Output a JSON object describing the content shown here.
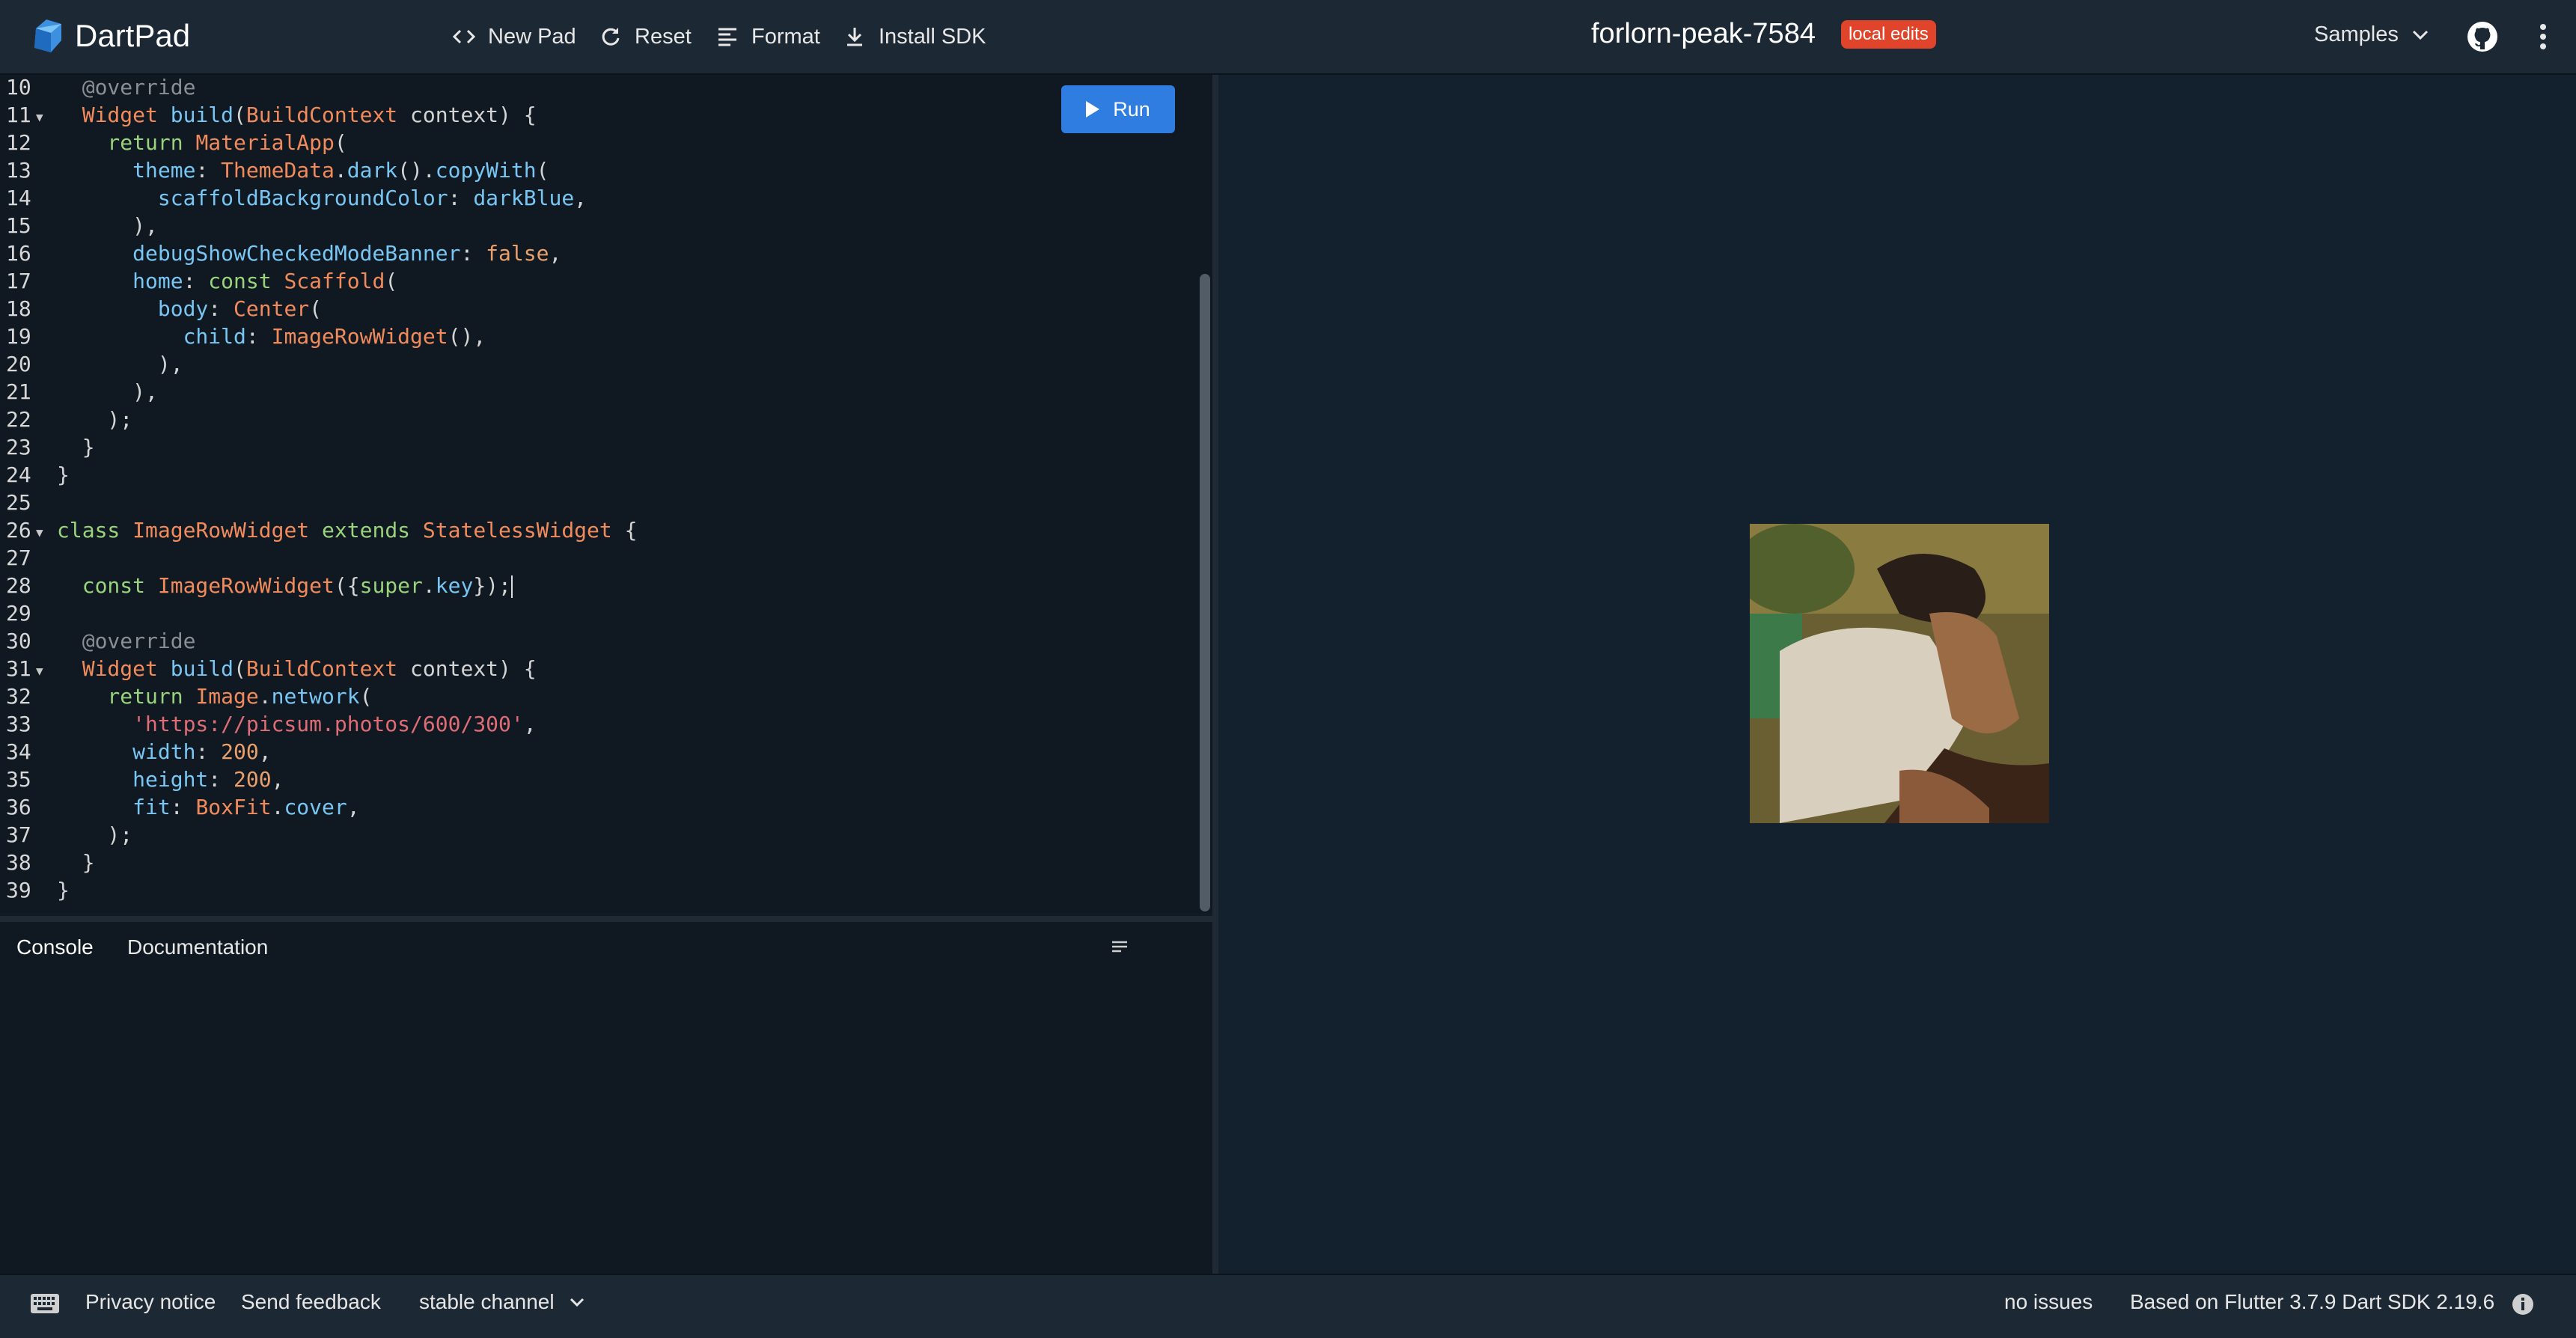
{
  "header": {
    "app_name": "DartPad",
    "nav": [
      {
        "label": "New Pad",
        "icon": "code-icon"
      },
      {
        "label": "Reset",
        "icon": "refresh-icon"
      },
      {
        "label": "Format",
        "icon": "format-align-icon"
      },
      {
        "label": "Install SDK",
        "icon": "download-icon"
      }
    ],
    "pad_title": "forlorn-peak-7584",
    "badge": "local edits",
    "samples_label": "Samples"
  },
  "editor": {
    "run_label": "Run",
    "lines": [
      {
        "n": "10",
        "fold": false
      },
      {
        "n": "11",
        "fold": true
      },
      {
        "n": "12",
        "fold": false
      },
      {
        "n": "13",
        "fold": false
      },
      {
        "n": "14",
        "fold": false
      },
      {
        "n": "15",
        "fold": false
      },
      {
        "n": "16",
        "fold": false
      },
      {
        "n": "17",
        "fold": false
      },
      {
        "n": "18",
        "fold": false
      },
      {
        "n": "19",
        "fold": false
      },
      {
        "n": "20",
        "fold": false
      },
      {
        "n": "21",
        "fold": false
      },
      {
        "n": "22",
        "fold": false
      },
      {
        "n": "23",
        "fold": false
      },
      {
        "n": "24",
        "fold": false
      },
      {
        "n": "25",
        "fold": false
      },
      {
        "n": "26",
        "fold": true
      },
      {
        "n": "27",
        "fold": false
      },
      {
        "n": "28",
        "fold": false
      },
      {
        "n": "29",
        "fold": false
      },
      {
        "n": "30",
        "fold": false
      },
      {
        "n": "31",
        "fold": true
      },
      {
        "n": "32",
        "fold": false
      },
      {
        "n": "33",
        "fold": false
      },
      {
        "n": "34",
        "fold": false
      },
      {
        "n": "35",
        "fold": false
      },
      {
        "n": "36",
        "fold": false
      },
      {
        "n": "37",
        "fold": false
      },
      {
        "n": "38",
        "fold": false
      },
      {
        "n": "39",
        "fold": false
      }
    ],
    "code": [
      [
        [
          "ann",
          "  @override"
        ]
      ],
      [
        [
          "cls",
          "  Widget "
        ],
        [
          "prop",
          "build"
        ],
        [
          "",
          "("
        ],
        [
          "cls",
          "BuildContext "
        ],
        [
          "",
          "context) {"
        ]
      ],
      [
        [
          "kw",
          "    return "
        ],
        [
          "cls",
          "MaterialApp"
        ],
        [
          "",
          "("
        ]
      ],
      [
        [
          "prop",
          "      theme"
        ],
        [
          "",
          ": "
        ],
        [
          "cls",
          "ThemeData"
        ],
        [
          "",
          "."
        ],
        [
          "prop",
          "dark"
        ],
        [
          "",
          "()."
        ],
        [
          "prop",
          "copyWith"
        ],
        [
          "",
          "("
        ]
      ],
      [
        [
          "prop",
          "        scaffoldBackgroundColor"
        ],
        [
          "",
          ": "
        ],
        [
          "prop",
          "darkBlue"
        ],
        [
          "",
          ","
        ]
      ],
      [
        [
          "",
          "      ),"
        ]
      ],
      [
        [
          "prop",
          "      debugShowCheckedModeBanner"
        ],
        [
          "",
          ": "
        ],
        [
          "num",
          "false"
        ],
        [
          "",
          ","
        ]
      ],
      [
        [
          "prop",
          "      home"
        ],
        [
          "",
          ": "
        ],
        [
          "kw",
          "const "
        ],
        [
          "cls",
          "Scaffold"
        ],
        [
          "",
          "("
        ]
      ],
      [
        [
          "prop",
          "        body"
        ],
        [
          "",
          ": "
        ],
        [
          "cls",
          "Center"
        ],
        [
          "",
          "("
        ]
      ],
      [
        [
          "prop",
          "          child"
        ],
        [
          "",
          ": "
        ],
        [
          "cls",
          "ImageRowWidget"
        ],
        [
          "",
          "(),"
        ]
      ],
      [
        [
          "",
          "        ),"
        ]
      ],
      [
        [
          "",
          "      ),"
        ]
      ],
      [
        [
          "",
          "    );"
        ]
      ],
      [
        [
          "",
          "  }"
        ]
      ],
      [
        [
          "",
          "}"
        ]
      ],
      [
        [
          "",
          ""
        ]
      ],
      [
        [
          "kw",
          "class "
        ],
        [
          "cls",
          "ImageRowWidget "
        ],
        [
          "kw",
          "extends "
        ],
        [
          "cls",
          "StatelessWidget "
        ],
        [
          "",
          "{"
        ]
      ],
      [
        [
          "",
          ""
        ]
      ],
      [
        [
          "kw",
          "  const "
        ],
        [
          "cls",
          "ImageRowWidget"
        ],
        [
          "",
          "({"
        ],
        [
          "kw",
          "super"
        ],
        [
          "",
          "."
        ],
        [
          "prop",
          "key"
        ],
        [
          "",
          "});"
        ]
      ],
      [
        [
          "",
          ""
        ]
      ],
      [
        [
          "ann",
          "  @override"
        ]
      ],
      [
        [
          "cls",
          "  Widget "
        ],
        [
          "prop",
          "build"
        ],
        [
          "",
          "("
        ],
        [
          "cls",
          "BuildContext "
        ],
        [
          "",
          "context) {"
        ]
      ],
      [
        [
          "kw",
          "    return "
        ],
        [
          "cls",
          "Image"
        ],
        [
          "",
          "."
        ],
        [
          "prop",
          "network"
        ],
        [
          "",
          "("
        ]
      ],
      [
        [
          "str",
          "      'https://picsum.photos/600/300'"
        ],
        [
          "",
          ","
        ]
      ],
      [
        [
          "prop",
          "      width"
        ],
        [
          "",
          ": "
        ],
        [
          "num",
          "200"
        ],
        [
          "",
          ","
        ]
      ],
      [
        [
          "prop",
          "      height"
        ],
        [
          "",
          ": "
        ],
        [
          "num",
          "200"
        ],
        [
          "",
          ","
        ]
      ],
      [
        [
          "prop",
          "      fit"
        ],
        [
          "",
          ": "
        ],
        [
          "cls",
          "BoxFit"
        ],
        [
          "",
          "."
        ],
        [
          "prop",
          "cover"
        ],
        [
          "",
          ","
        ]
      ],
      [
        [
          "",
          "    );"
        ]
      ],
      [
        [
          "",
          "  }"
        ]
      ],
      [
        [
          "",
          "}"
        ]
      ]
    ]
  },
  "console": {
    "tabs": [
      "Console",
      "Documentation"
    ]
  },
  "footer": {
    "privacy": "Privacy notice",
    "feedback": "Send feedback",
    "channel": "stable channel",
    "issues": "no issues",
    "version": "Based on Flutter 3.7.9 Dart SDK 2.19.6"
  },
  "colors": {
    "accent": "#2f7de1",
    "badge": "#e0442a",
    "header_bg": "#1c2834",
    "editor_bg": "#101922"
  }
}
